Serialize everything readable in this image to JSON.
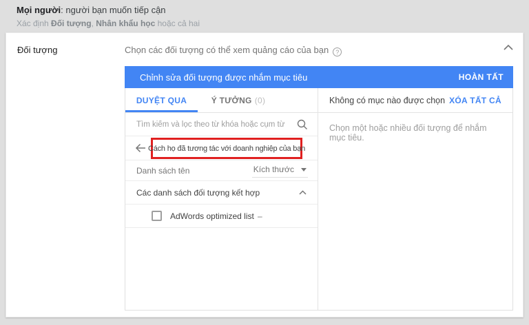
{
  "header": {
    "line1_bold": "Mọi người",
    "line1_rest": ": người bạn muốn tiếp cận",
    "line2_prefix": "Xác định ",
    "line2_bold1": "Đối tượng",
    "line2_sep": ", ",
    "line2_bold2": "Nhân khẩu học",
    "line2_suffix": " hoặc cả hai"
  },
  "card": {
    "row_label": "Đối tượng",
    "row_title": "Chọn các đối tượng có thể xem quảng cáo của bạn",
    "help_glyph": "?"
  },
  "editor": {
    "title": "Chỉnh sửa đối tượng được nhắm mục tiêu",
    "done_label": "HOÀN TẤT",
    "accent_color": "#4285f4"
  },
  "browse_panel": {
    "tabs": [
      {
        "label": "DUYỆT QUA",
        "active": true
      },
      {
        "label": "Ý TƯỞNG",
        "count": "(0)",
        "active": false
      }
    ],
    "search_placeholder": "Tìm kiếm và lọc theo từ khóa hoặc cụm từ",
    "breadcrumb": "Cách họ đã tương tác với doanh nghiệp của bạn",
    "highlight_color": "#e02020",
    "list_header": "Danh sách tên",
    "sort_label": "Kích thước",
    "section_title": "Các danh sách đối tượng kết hợp",
    "items": [
      {
        "label": "AdWords optimized list",
        "meta": "–",
        "checked": false
      }
    ]
  },
  "selection_panel": {
    "header": "Không có mục nào được chọn",
    "clear_label": "XÓA TẤT CẢ",
    "empty_message": "Chọn một hoặc nhiều đối tượng để nhắm mục tiêu."
  },
  "icons": [
    "help-icon",
    "chevron-up-icon",
    "search-icon",
    "arrow-left-icon",
    "caret-down-icon",
    "checkbox"
  ]
}
